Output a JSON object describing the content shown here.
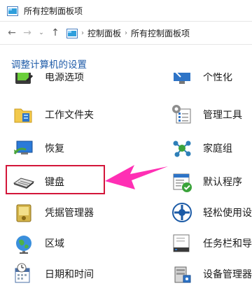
{
  "window": {
    "title": "所有控制面板项"
  },
  "nav": {
    "back_glyph": "←",
    "forward_glyph": "→",
    "dropdown_glyph": "⌄",
    "up_glyph": "↑",
    "breadcrumb_sep": "›",
    "breadcrumbs": [
      "控制面板",
      "所有控制面板项"
    ]
  },
  "heading": "调整计算机的设置",
  "items": {
    "col1": [
      {
        "label": "电源选项",
        "icon": "power-options-icon"
      },
      {
        "label": "工作文件夹",
        "icon": "work-folders-icon"
      },
      {
        "label": "恢复",
        "icon": "recovery-icon"
      },
      {
        "label": "键盘",
        "icon": "keyboard-icon"
      },
      {
        "label": "凭据管理器",
        "icon": "credential-manager-icon"
      },
      {
        "label": "区域",
        "icon": "region-icon"
      },
      {
        "label": "日期和时间",
        "icon": "date-time-icon"
      }
    ],
    "col2": [
      {
        "label": "个性化",
        "icon": "personalization-icon"
      },
      {
        "label": "管理工具",
        "icon": "administrative-tools-icon"
      },
      {
        "label": "家庭组",
        "icon": "homegroup-icon"
      },
      {
        "label": "默认程序",
        "icon": "default-programs-icon"
      },
      {
        "label": "轻松使用设置",
        "icon": "ease-of-access-icon"
      },
      {
        "label": "任务栏和导航",
        "icon": "taskbar-navigation-icon"
      },
      {
        "label": "设备管理器",
        "icon": "device-manager-icon"
      }
    ]
  },
  "colors": {
    "heading": "#1e5ba8",
    "highlight": "#d3163a",
    "arrow": "#ff2fb4"
  }
}
